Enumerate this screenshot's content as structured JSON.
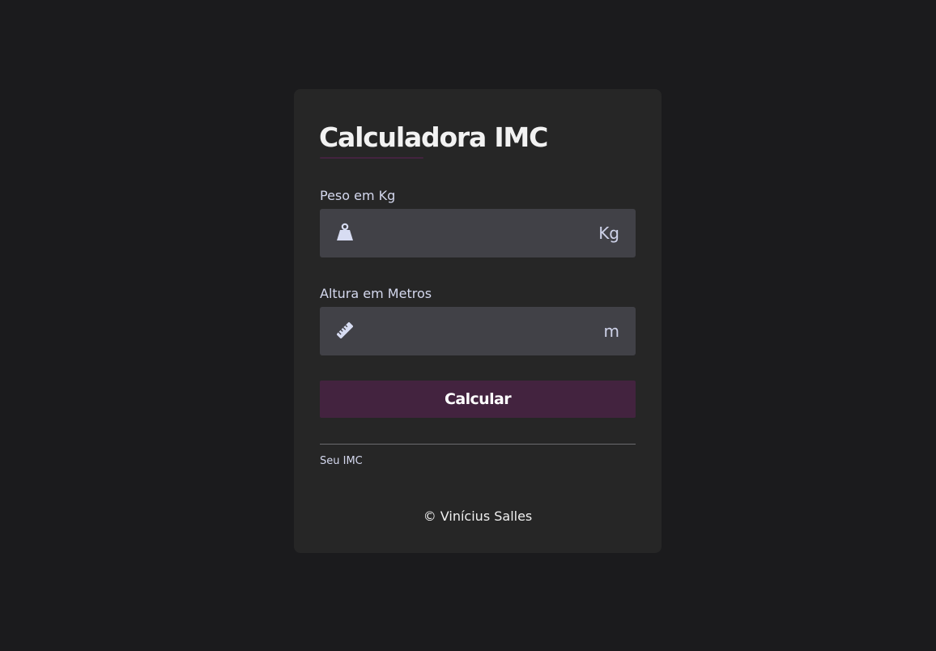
{
  "app": {
    "title": "Calculadora IMC"
  },
  "colors": {
    "background": "#1b1b1d",
    "card": "#262626",
    "field": "#414147",
    "accent": "#43233f",
    "underline": "#43233f"
  },
  "weight": {
    "label": "Peso em Kg",
    "icon": "weight-icon",
    "unit": "Kg",
    "value": ""
  },
  "height": {
    "label": "Altura em Metros",
    "icon": "ruler-icon",
    "unit": "m",
    "value": ""
  },
  "button": {
    "label": "Calcular"
  },
  "result": {
    "label": "Seu IMC"
  },
  "footer": {
    "text": "© Vinícius Salles"
  }
}
